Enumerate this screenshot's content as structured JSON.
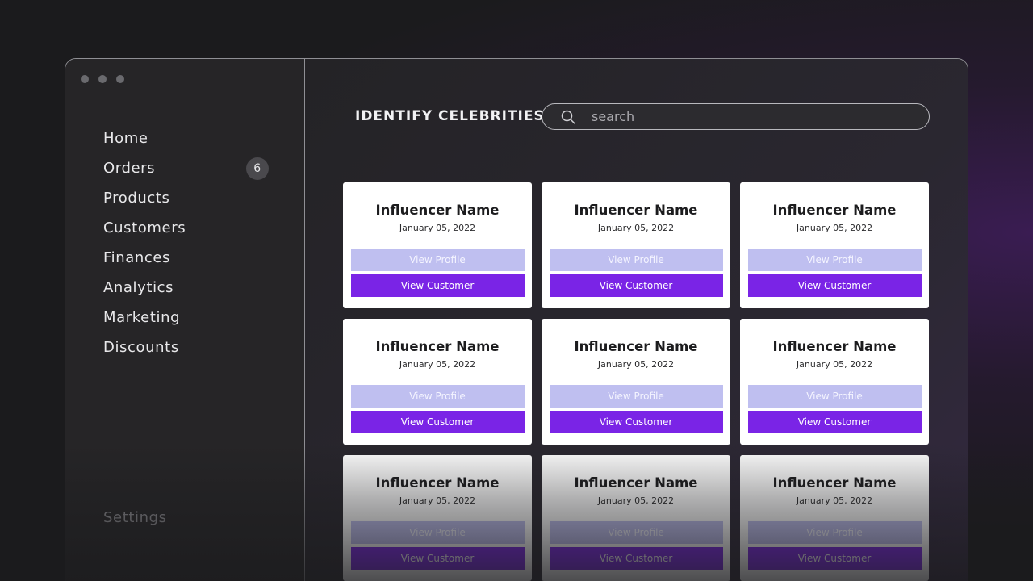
{
  "window": {
    "controls": [
      "close",
      "minimize",
      "maximize"
    ]
  },
  "sidebar": {
    "items": [
      {
        "label": "Home"
      },
      {
        "label": "Orders",
        "badge": "6"
      },
      {
        "label": "Products"
      },
      {
        "label": "Customers"
      },
      {
        "label": "Finances"
      },
      {
        "label": "Analytics"
      },
      {
        "label": "Marketing"
      },
      {
        "label": "Discounts"
      }
    ],
    "settings_label": "Settings"
  },
  "header": {
    "title": "IDENTIFY CELEBRITIES",
    "search": {
      "placeholder": "search",
      "value": "",
      "icon": "search-icon"
    }
  },
  "cards": [
    {
      "name": "Influencer Name",
      "date": "January 05, 2022",
      "profile_label": "View Profile",
      "customer_label": "View Customer"
    },
    {
      "name": "Influencer Name",
      "date": "January 05, 2022",
      "profile_label": "View Profile",
      "customer_label": "View Customer"
    },
    {
      "name": "Influencer Name",
      "date": "January 05, 2022",
      "profile_label": "View Profile",
      "customer_label": "View Customer"
    },
    {
      "name": "Influencer Name",
      "date": "January 05, 2022",
      "profile_label": "View Profile",
      "customer_label": "View Customer"
    },
    {
      "name": "Influencer Name",
      "date": "January 05, 2022",
      "profile_label": "View Profile",
      "customer_label": "View Customer"
    },
    {
      "name": "Influencer Name",
      "date": "January 05, 2022",
      "profile_label": "View Profile",
      "customer_label": "View Customer"
    },
    {
      "name": "Influencer Name",
      "date": "January 05, 2022",
      "profile_label": "View Profile",
      "customer_label": "View Customer"
    },
    {
      "name": "Influencer Name",
      "date": "January 05, 2022",
      "profile_label": "View Profile",
      "customer_label": "View Customer"
    },
    {
      "name": "Influencer Name",
      "date": "January 05, 2022",
      "profile_label": "View Profile",
      "customer_label": "View Customer"
    }
  ],
  "colors": {
    "accent": "#7a24e6",
    "secondary_button": "#bfbff0",
    "background": "#1b1b1d"
  }
}
